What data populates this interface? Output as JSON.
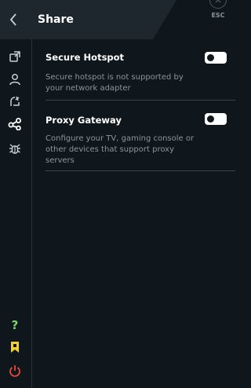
{
  "header": {
    "title": "Share",
    "back_icon": "chevron-left-icon",
    "esc_label": "ESC",
    "esc_icon": "close-icon"
  },
  "sidebar": {
    "items": [
      {
        "name": "share-link-icon",
        "active": false
      },
      {
        "name": "user-icon",
        "active": false
      },
      {
        "name": "block-icon",
        "active": false
      },
      {
        "name": "share-nodes-icon",
        "active": true
      },
      {
        "name": "bug-icon",
        "active": false
      }
    ],
    "bottom": [
      {
        "name": "help-icon",
        "label": "?",
        "color": "#7cd96b"
      },
      {
        "name": "bookmark-icon",
        "color": "#f2d230"
      },
      {
        "name": "power-icon",
        "color": "#e84a3a"
      }
    ]
  },
  "sections": [
    {
      "title": "Secure Hotspot",
      "description": "Secure hotspot is not supported by your network adapter",
      "enabled": false
    },
    {
      "title": "Proxy Gateway",
      "description": "Configure your TV, gaming console or other devices that support proxy servers",
      "enabled": false
    }
  ],
  "colors": {
    "background": "#0f171c",
    "header_tab": "#1d272d",
    "icon": "#c9d0d4",
    "text_secondary": "#8a959c"
  }
}
